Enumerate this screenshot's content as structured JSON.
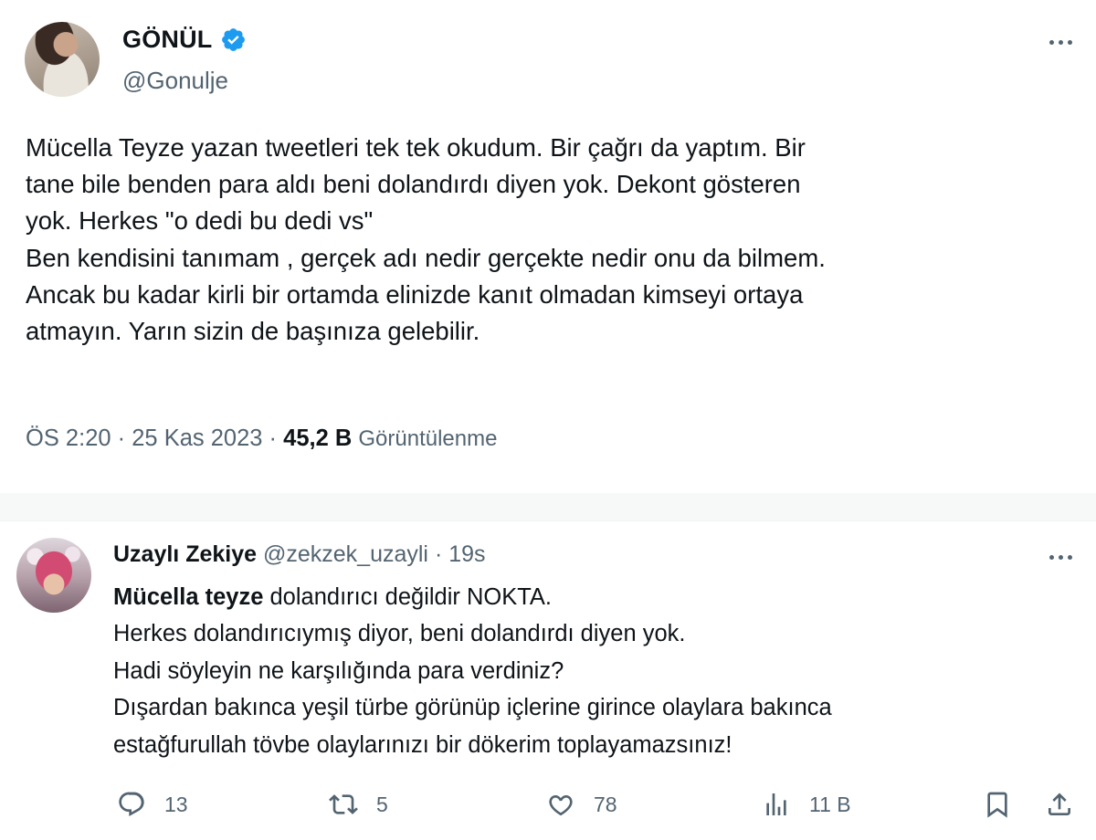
{
  "main_tweet": {
    "author_name": "GÖNÜL",
    "handle": "@Gonulje",
    "text_lines": [
      "Mücella Teyze yazan tweetleri tek tek okudum. Bir çağrı da yaptım. Bir",
      "tane bile benden para aldı beni dolandırdı diyen yok. Dekont gösteren",
      "yok. Herkes \"o dedi bu dedi vs\"",
      "Ben kendisini tanımam , gerçek adı nedir gerçekte nedir onu da bilmem.",
      "Ancak bu kadar kirli bir ortamda elinizde kanıt olmadan kimseyi ortaya",
      "atmayın. Yarın sizin de başınıza gelebilir."
    ],
    "time": "ÖS 2:20",
    "separator": "·",
    "date": "25 Kas 2023",
    "views_count": "45,2 B",
    "views_label": "Görüntülenme",
    "verified_color": "#1d9bf0"
  },
  "reply": {
    "author_name": "Uzaylı Zekiye",
    "handle": "@zekzek_uzayli",
    "separator": "·",
    "time_ago": "19s",
    "first_line_bold": "Mücella teyze",
    "first_line_rest": " dolandırıcı değildir NOKTA.",
    "text_lines": [
      "Herkes dolandırıcıymış diyor, beni dolandırdı diyen yok.",
      "Hadi söyleyin ne karşılığında para verdiniz?",
      "Dışardan bakınca yeşil türbe görünüp içlerine girince olaylara bakınca",
      "estağfurullah tövbe olaylarınızı bir dökerim toplayamazsınız!"
    ],
    "actions": {
      "reply_count": "13",
      "retweet_count": "5",
      "like_count": "78",
      "views_count": "11 B"
    },
    "icons": [
      "comment-icon",
      "retweet-icon",
      "heart-icon",
      "analytics-icon",
      "bookmark-icon",
      "share-icon"
    ]
  },
  "colors": {
    "text": "#0f1419",
    "secondary": "#536471",
    "accent": "#1d9bf0",
    "separator_bg": "#f7f9f9"
  }
}
